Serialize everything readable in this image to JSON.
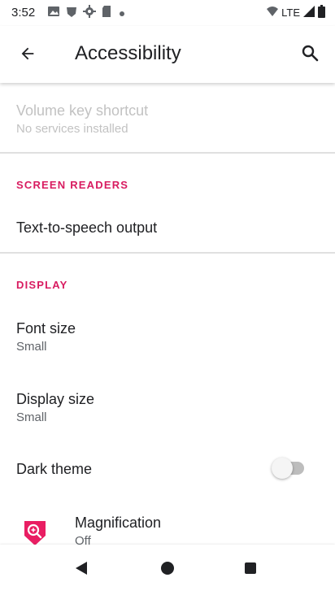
{
  "status_bar": {
    "time": "3:52",
    "network": "LTE",
    "notification_icons": [
      "photos-icon",
      "vpn-key-icon",
      "settings-gear-icon",
      "sd-card-icon",
      "dot-icon"
    ],
    "status_icons": [
      "wifi-icon",
      "signal-icon",
      "battery-icon"
    ]
  },
  "app_bar": {
    "title": "Accessibility",
    "back_icon": "back-arrow-icon",
    "search_icon": "search-icon"
  },
  "list": {
    "volume_key": {
      "title": "Volume key shortcut",
      "subtitle": "No services installed",
      "enabled": false
    },
    "screen_readers_header": "SCREEN READERS",
    "tts": {
      "title": "Text-to-speech output"
    },
    "display_header": "DISPLAY",
    "font_size": {
      "title": "Font size",
      "subtitle": "Small"
    },
    "display_size": {
      "title": "Display size",
      "subtitle": "Small"
    },
    "dark_theme": {
      "title": "Dark theme",
      "checked": false
    },
    "magnification": {
      "title": "Magnification",
      "subtitle": "Off",
      "icon": "magnification-icon"
    }
  },
  "nav_bar": {
    "back": "nav-back-icon",
    "home": "nav-home-icon",
    "recents": "nav-recents-icon"
  },
  "colors": {
    "accent": "#d81b60",
    "text_primary": "#202124",
    "text_secondary": "#5f6368",
    "disabled": "#c2c2c2"
  }
}
